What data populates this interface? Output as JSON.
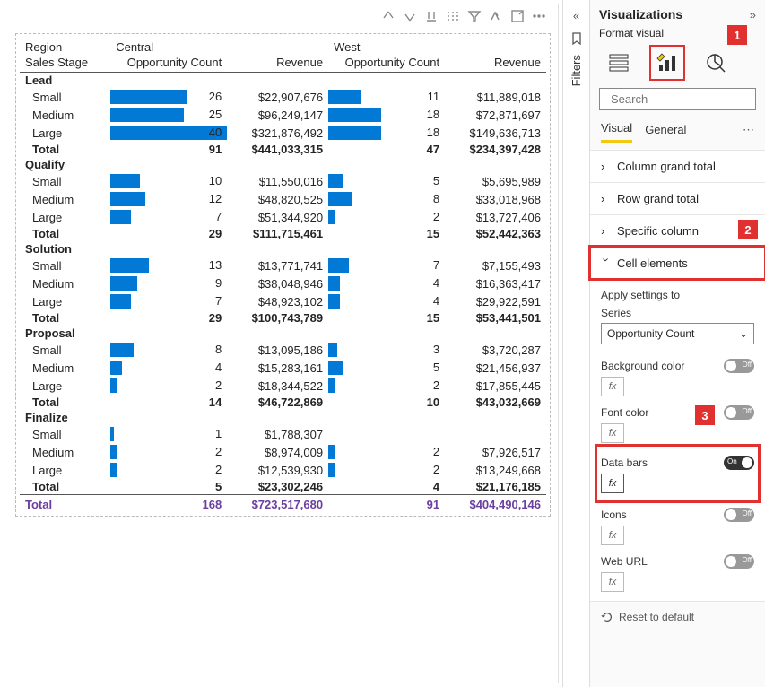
{
  "panel": {
    "title": "Visualizations",
    "subtitle": "Format visual",
    "search_placeholder": "Search",
    "tabs": {
      "visual": "Visual",
      "general": "General"
    }
  },
  "accordion": {
    "col_grand_total": "Column grand total",
    "row_grand_total": "Row grand total",
    "specific_column": "Specific column",
    "cell_elements": "Cell elements"
  },
  "settings": {
    "apply_label": "Apply settings to",
    "series_label": "Series",
    "series_value": "Opportunity Count",
    "bg_color": "Background color",
    "font_color": "Font color",
    "data_bars": "Data bars",
    "icons": "Icons",
    "web_url": "Web URL",
    "reset": "Reset to default",
    "fx": "fx",
    "on": "On",
    "off": "Off"
  },
  "filters_label": "Filters",
  "callouts": {
    "c1": "1",
    "c2": "2",
    "c3": "3"
  },
  "matrix": {
    "headers": {
      "region": "Region",
      "stage": "Sales Stage",
      "central": "Central",
      "west": "West",
      "count": "Opportunity Count",
      "revenue": "Revenue",
      "total": "Total"
    },
    "max_count": 40,
    "groups": [
      {
        "name": "Lead",
        "rows": [
          {
            "label": "Small",
            "c_cnt": 26,
            "c_rev": "$22,907,676",
            "w_cnt": 11,
            "w_rev": "$11,889,018"
          },
          {
            "label": "Medium",
            "c_cnt": 25,
            "c_rev": "$96,249,147",
            "w_cnt": 18,
            "w_rev": "$72,871,697"
          },
          {
            "label": "Large",
            "c_cnt": 40,
            "c_rev": "$321,876,492",
            "w_cnt": 18,
            "w_rev": "$149,636,713"
          }
        ],
        "total": {
          "c_cnt": 91,
          "c_rev": "$441,033,315",
          "w_cnt": 47,
          "w_rev": "$234,397,428"
        }
      },
      {
        "name": "Qualify",
        "rows": [
          {
            "label": "Small",
            "c_cnt": 10,
            "c_rev": "$11,550,016",
            "w_cnt": 5,
            "w_rev": "$5,695,989"
          },
          {
            "label": "Medium",
            "c_cnt": 12,
            "c_rev": "$48,820,525",
            "w_cnt": 8,
            "w_rev": "$33,018,968"
          },
          {
            "label": "Large",
            "c_cnt": 7,
            "c_rev": "$51,344,920",
            "w_cnt": 2,
            "w_rev": "$13,727,406"
          }
        ],
        "total": {
          "c_cnt": 29,
          "c_rev": "$111,715,461",
          "w_cnt": 15,
          "w_rev": "$52,442,363"
        }
      },
      {
        "name": "Solution",
        "rows": [
          {
            "label": "Small",
            "c_cnt": 13,
            "c_rev": "$13,771,741",
            "w_cnt": 7,
            "w_rev": "$7,155,493"
          },
          {
            "label": "Medium",
            "c_cnt": 9,
            "c_rev": "$38,048,946",
            "w_cnt": 4,
            "w_rev": "$16,363,417"
          },
          {
            "label": "Large",
            "c_cnt": 7,
            "c_rev": "$48,923,102",
            "w_cnt": 4,
            "w_rev": "$29,922,591"
          }
        ],
        "total": {
          "c_cnt": 29,
          "c_rev": "$100,743,789",
          "w_cnt": 15,
          "w_rev": "$53,441,501"
        }
      },
      {
        "name": "Proposal",
        "rows": [
          {
            "label": "Small",
            "c_cnt": 8,
            "c_rev": "$13,095,186",
            "w_cnt": 3,
            "w_rev": "$3,720,287"
          },
          {
            "label": "Medium",
            "c_cnt": 4,
            "c_rev": "$15,283,161",
            "w_cnt": 5,
            "w_rev": "$21,456,937"
          },
          {
            "label": "Large",
            "c_cnt": 2,
            "c_rev": "$18,344,522",
            "w_cnt": 2,
            "w_rev": "$17,855,445"
          }
        ],
        "total": {
          "c_cnt": 14,
          "c_rev": "$46,722,869",
          "w_cnt": 10,
          "w_rev": "$43,032,669"
        }
      },
      {
        "name": "Finalize",
        "rows": [
          {
            "label": "Small",
            "c_cnt": 1,
            "c_rev": "$1,788,307",
            "w_cnt": null,
            "w_rev": ""
          },
          {
            "label": "Medium",
            "c_cnt": 2,
            "c_rev": "$8,974,009",
            "w_cnt": 2,
            "w_rev": "$7,926,517"
          },
          {
            "label": "Large",
            "c_cnt": 2,
            "c_rev": "$12,539,930",
            "w_cnt": 2,
            "w_rev": "$13,249,668"
          }
        ],
        "total": {
          "c_cnt": 5,
          "c_rev": "$23,302,246",
          "w_cnt": 4,
          "w_rev": "$21,176,185"
        }
      }
    ],
    "grand": {
      "label": "Total",
      "c_cnt": 168,
      "c_rev": "$723,517,680",
      "w_cnt": 91,
      "w_rev": "$404,490,146"
    }
  }
}
